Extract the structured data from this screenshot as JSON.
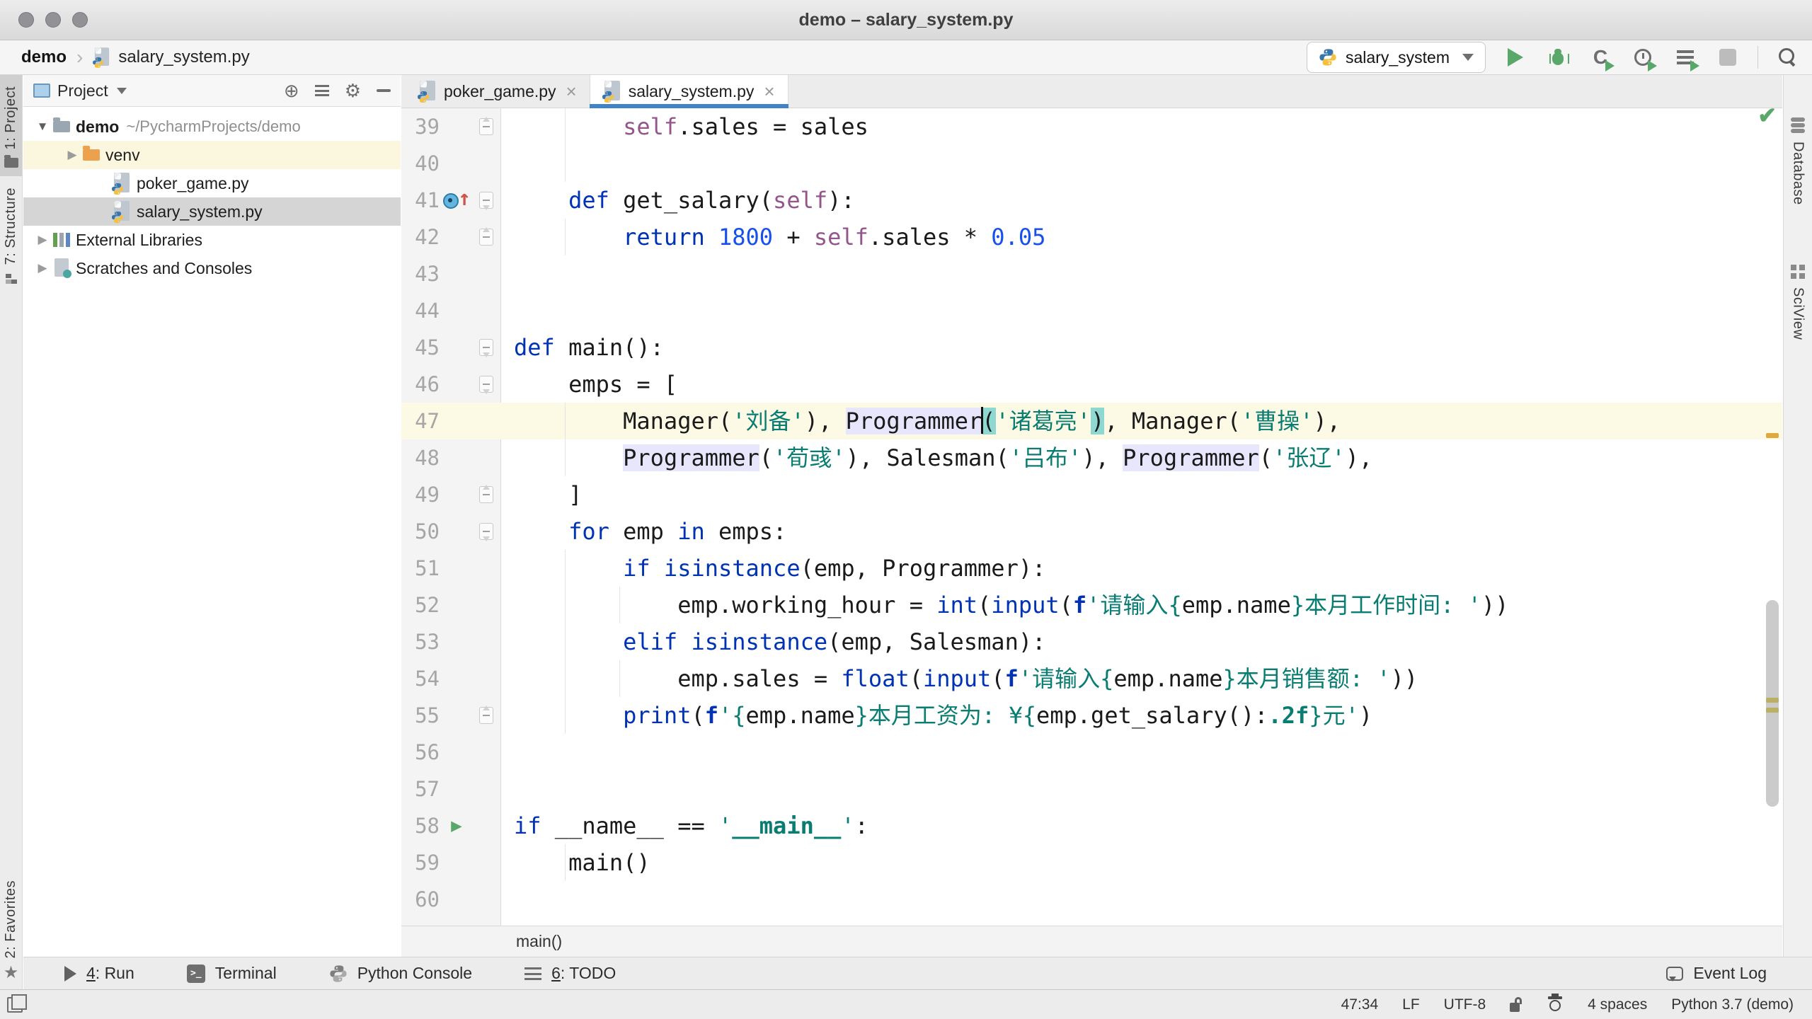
{
  "window": {
    "title": "demo – salary_system.py"
  },
  "breadcrumb": {
    "project": "demo",
    "file": "salary_system.py"
  },
  "run": {
    "config": "salary_system"
  },
  "colors": {
    "accent_tab_underline": "#4083c9",
    "keyword": "#0033b3",
    "number": "#1750eb",
    "self": "#94558d",
    "string": "#0a7d73",
    "current_line": "#fcf9e4",
    "identifier_highlight": "#e8e6fc",
    "brace_match": "#8fd8d2",
    "selection": "#d5d5d5",
    "run_green": "#59a869"
  },
  "left_strip": {
    "items": [
      {
        "label": "1: Project",
        "icon": "project-folder-icon",
        "active": true,
        "bottom": false
      },
      {
        "label": "7: Structure",
        "icon": "structure-icon",
        "active": false,
        "bottom": false
      },
      {
        "label": "2: Favorites",
        "icon": "star-icon",
        "active": false,
        "bottom": true
      }
    ]
  },
  "right_strip": {
    "items": [
      {
        "label": "Database",
        "icon": "database-icon"
      },
      {
        "label": "SciView",
        "icon": "grid-icon"
      }
    ]
  },
  "project_panel": {
    "header": {
      "title": "Project",
      "icons": [
        "locate-icon",
        "collapse-all-icon",
        "gear-icon",
        "hide-icon"
      ]
    },
    "tree": [
      {
        "label": "demo",
        "path": "~/PycharmProjects/demo",
        "icon": "folder-slate",
        "expander": "open",
        "bold": true,
        "pad": 12,
        "bg": ""
      },
      {
        "label": "venv",
        "path": "",
        "icon": "folder-orange",
        "expander": "closed",
        "bold": false,
        "pad": 54,
        "bg": "row-yellow"
      },
      {
        "label": "poker_game.py",
        "path": "",
        "icon": "python-file",
        "expander": "none",
        "bold": false,
        "pad": 96,
        "bg": ""
      },
      {
        "label": "salary_system.py",
        "path": "",
        "icon": "python-file",
        "expander": "none",
        "bold": false,
        "pad": 96,
        "bg": "row-selected"
      },
      {
        "label": "External Libraries",
        "path": "",
        "icon": "libraries",
        "expander": "closed",
        "bold": false,
        "pad": 12,
        "bg": ""
      },
      {
        "label": "Scratches and Consoles",
        "path": "",
        "icon": "scratch",
        "expander": "closed",
        "bold": false,
        "pad": 12,
        "bg": ""
      }
    ]
  },
  "editor": {
    "tabs": [
      {
        "label": "poker_game.py",
        "active": false
      },
      {
        "label": "salary_system.py",
        "active": true
      }
    ],
    "crumb": "main()",
    "lines": [
      {
        "n": 39,
        "fold": "up",
        "icon": "",
        "guides": [
          4
        ],
        "seg": [
          [
            "pl",
            "        "
          ],
          [
            "self",
            "self"
          ],
          [
            "pl",
            ".sales = sales"
          ]
        ]
      },
      {
        "n": 40,
        "fold": "",
        "icon": "",
        "guides": [
          4
        ],
        "seg": []
      },
      {
        "n": 41,
        "fold": "down",
        "icon": "override",
        "guides": [],
        "seg": [
          [
            "pl",
            "    "
          ],
          [
            "kw",
            "def"
          ],
          [
            "pl",
            " get_salary("
          ],
          [
            "self",
            "self"
          ],
          [
            "pl",
            "):"
          ]
        ]
      },
      {
        "n": 42,
        "fold": "up",
        "icon": "",
        "guides": [
          4
        ],
        "seg": [
          [
            "pl",
            "        "
          ],
          [
            "kw",
            "return"
          ],
          [
            "pl",
            " "
          ],
          [
            "num",
            "1800"
          ],
          [
            "pl",
            " + "
          ],
          [
            "self",
            "self"
          ],
          [
            "pl",
            ".sales * "
          ],
          [
            "num",
            "0.05"
          ]
        ]
      },
      {
        "n": 43,
        "fold": "",
        "icon": "",
        "guides": [],
        "seg": []
      },
      {
        "n": 44,
        "fold": "",
        "icon": "",
        "guides": [],
        "seg": []
      },
      {
        "n": 45,
        "fold": "down",
        "icon": "",
        "guides": [],
        "seg": [
          [
            "kw",
            "def"
          ],
          [
            "pl",
            " main():"
          ]
        ]
      },
      {
        "n": 46,
        "fold": "down",
        "icon": "",
        "guides": [],
        "seg": [
          [
            "pl",
            "    "
          ],
          [
            "pl",
            "emps = ["
          ]
        ]
      },
      {
        "n": 47,
        "fold": "",
        "icon": "",
        "cur": true,
        "guides": [
          4
        ],
        "seg": [
          [
            "pl",
            "        "
          ],
          [
            "pl",
            "Manager("
          ],
          [
            "str",
            "'刘备'"
          ],
          [
            "pl",
            "), "
          ],
          [
            "id",
            "Programmer"
          ],
          [
            "caret",
            ""
          ],
          [
            "mp",
            "("
          ],
          [
            "str",
            "'诸葛亮'"
          ],
          [
            "mp",
            ")"
          ],
          [
            "pl",
            ", Manager("
          ],
          [
            "str",
            "'曹操'"
          ],
          [
            "pl",
            "),"
          ]
        ]
      },
      {
        "n": 48,
        "fold": "",
        "icon": "",
        "guides": [
          4
        ],
        "seg": [
          [
            "pl",
            "        "
          ],
          [
            "id",
            "Programmer"
          ],
          [
            "pl",
            "("
          ],
          [
            "str",
            "'荀彧'"
          ],
          [
            "pl",
            "), Salesman("
          ],
          [
            "str",
            "'吕布'"
          ],
          [
            "pl",
            "), "
          ],
          [
            "id",
            "Programmer"
          ],
          [
            "pl",
            "("
          ],
          [
            "str",
            "'张辽'"
          ],
          [
            "pl",
            "),"
          ]
        ]
      },
      {
        "n": 49,
        "fold": "up",
        "icon": "",
        "guides": [],
        "seg": [
          [
            "pl",
            "    "
          ],
          [
            "pl",
            "]"
          ]
        ]
      },
      {
        "n": 50,
        "fold": "down",
        "icon": "",
        "guides": [],
        "seg": [
          [
            "pl",
            "    "
          ],
          [
            "kw",
            "for"
          ],
          [
            "pl",
            " emp "
          ],
          [
            "kw",
            "in"
          ],
          [
            "pl",
            " emps:"
          ]
        ]
      },
      {
        "n": 51,
        "fold": "",
        "icon": "",
        "guides": [
          4
        ],
        "seg": [
          [
            "pl",
            "        "
          ],
          [
            "kw",
            "if"
          ],
          [
            "pl",
            " "
          ],
          [
            "kw",
            "isinstance"
          ],
          [
            "pl",
            "(emp, Programmer):"
          ]
        ]
      },
      {
        "n": 52,
        "fold": "",
        "icon": "",
        "guides": [
          4,
          8
        ],
        "seg": [
          [
            "pl",
            "            "
          ],
          [
            "pl",
            "emp.working_hour = "
          ],
          [
            "kw",
            "int"
          ],
          [
            "pl",
            "("
          ],
          [
            "kw",
            "input"
          ],
          [
            "pl",
            "("
          ],
          [
            "fx",
            "f"
          ],
          [
            "str",
            "'请输入"
          ],
          [
            "br",
            "{"
          ],
          [
            "pl",
            "emp.name"
          ],
          [
            "br",
            "}"
          ],
          [
            "str",
            "本月工作时间: '"
          ],
          [
            "pl",
            "))"
          ]
        ]
      },
      {
        "n": 53,
        "fold": "",
        "icon": "",
        "guides": [
          4
        ],
        "seg": [
          [
            "pl",
            "        "
          ],
          [
            "kw",
            "elif"
          ],
          [
            "pl",
            " "
          ],
          [
            "kw",
            "isinstance"
          ],
          [
            "pl",
            "(emp, Salesman):"
          ]
        ]
      },
      {
        "n": 54,
        "fold": "",
        "icon": "",
        "guides": [
          4,
          8
        ],
        "seg": [
          [
            "pl",
            "            "
          ],
          [
            "pl",
            "emp.sales = "
          ],
          [
            "kw",
            "float"
          ],
          [
            "pl",
            "("
          ],
          [
            "kw",
            "input"
          ],
          [
            "pl",
            "("
          ],
          [
            "fx",
            "f"
          ],
          [
            "str",
            "'请输入"
          ],
          [
            "br",
            "{"
          ],
          [
            "pl",
            "emp.name"
          ],
          [
            "br",
            "}"
          ],
          [
            "str",
            "本月销售额: '"
          ],
          [
            "pl",
            "))"
          ]
        ]
      },
      {
        "n": 55,
        "fold": "up",
        "icon": "",
        "guides": [
          4
        ],
        "seg": [
          [
            "pl",
            "        "
          ],
          [
            "kw",
            "print"
          ],
          [
            "pl",
            "("
          ],
          [
            "fx",
            "f"
          ],
          [
            "str",
            "'"
          ],
          [
            "br",
            "{"
          ],
          [
            "pl",
            "emp.name"
          ],
          [
            "br",
            "}"
          ],
          [
            "str",
            "本月工资为: ¥"
          ],
          [
            "br",
            "{"
          ],
          [
            "pl",
            "emp.get_salary():"
          ],
          [
            "strb",
            ".2f"
          ],
          [
            "br",
            "}"
          ],
          [
            "str",
            "元'"
          ],
          [
            "pl",
            ")"
          ]
        ]
      },
      {
        "n": 56,
        "fold": "",
        "icon": "",
        "guides": [],
        "seg": []
      },
      {
        "n": 57,
        "fold": "",
        "icon": "",
        "guides": [],
        "seg": []
      },
      {
        "n": 58,
        "fold": "",
        "icon": "run",
        "guides": [],
        "seg": [
          [
            "kw",
            "if"
          ],
          [
            "pl",
            " __name__ == "
          ],
          [
            "str",
            "'"
          ],
          [
            "strb",
            "__main__"
          ],
          [
            "str",
            "'"
          ],
          [
            "pl",
            ":"
          ]
        ]
      },
      {
        "n": 59,
        "fold": "",
        "icon": "",
        "guides": [
          4
        ],
        "seg": [
          [
            "pl",
            "    "
          ],
          [
            "pl",
            "main()"
          ]
        ]
      },
      {
        "n": 60,
        "fold": "",
        "icon": "",
        "guides": [],
        "seg": []
      }
    ]
  },
  "toolwindow_bar": {
    "left": [
      {
        "icon": "run-icon",
        "label": "4: Run",
        "underline": 0
      },
      {
        "icon": "terminal-icon",
        "label": "Terminal",
        "underline": null
      },
      {
        "icon": "python-console-icon",
        "label": "Python Console",
        "underline": null
      },
      {
        "icon": "todo-icon",
        "label": "6: TODO",
        "underline": 0
      }
    ],
    "event_log": "Event Log"
  },
  "status": {
    "position": "47:34",
    "line_separator": "LF",
    "encoding": "UTF-8",
    "indent": "4 spaces",
    "interpreter": "Python 3.7 (demo)"
  }
}
